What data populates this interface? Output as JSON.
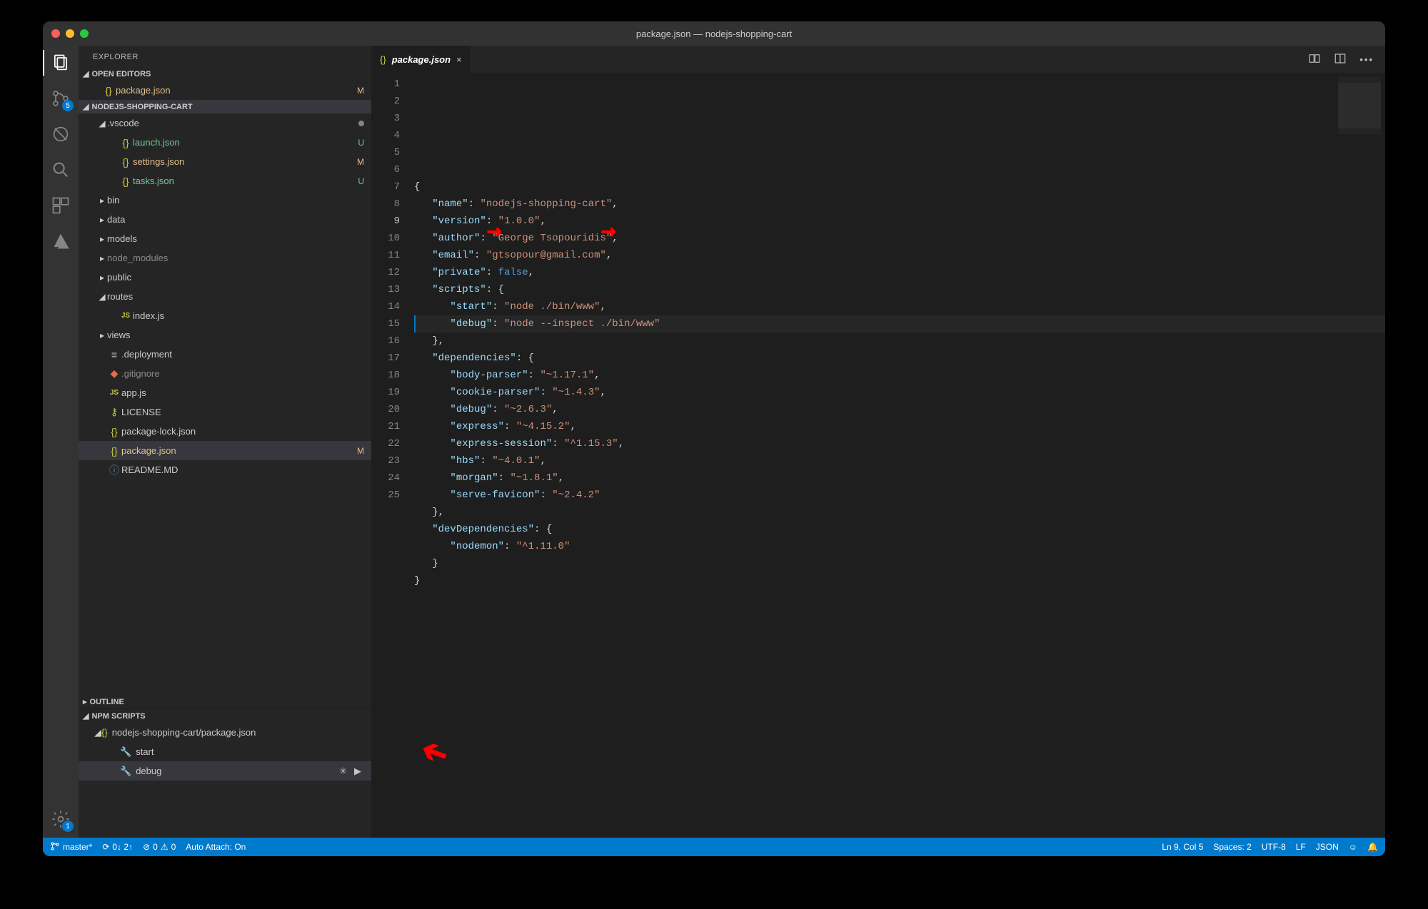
{
  "window": {
    "title": "package.json — nodejs-shopping-cart"
  },
  "activity": {
    "scm_badge": "5",
    "settings_badge": "1"
  },
  "sidebar": {
    "title": "EXPLORER",
    "open_editors": {
      "title": "OPEN EDITORS",
      "items": [
        {
          "label": "package.json",
          "decoration": "M"
        }
      ]
    },
    "workspace": {
      "title": "NODEJS-SHOPPING-CART",
      "tree": [
        {
          "depth": 1,
          "kind": "folder",
          "expanded": true,
          "label": ".vscode",
          "dotdeco": true
        },
        {
          "depth": 2,
          "kind": "json",
          "label": "launch.json",
          "color": "green",
          "decoration": "U"
        },
        {
          "depth": 2,
          "kind": "json",
          "label": "settings.json",
          "color": "gold",
          "decoration": "M"
        },
        {
          "depth": 2,
          "kind": "json",
          "label": "tasks.json",
          "color": "green",
          "decoration": "U"
        },
        {
          "depth": 1,
          "kind": "folder",
          "expanded": false,
          "label": "bin"
        },
        {
          "depth": 1,
          "kind": "folder",
          "expanded": false,
          "label": "data"
        },
        {
          "depth": 1,
          "kind": "folder",
          "expanded": false,
          "label": "models"
        },
        {
          "depth": 1,
          "kind": "folder",
          "expanded": false,
          "label": "node_modules",
          "color": "gray"
        },
        {
          "depth": 1,
          "kind": "folder",
          "expanded": false,
          "label": "public"
        },
        {
          "depth": 1,
          "kind": "folder",
          "expanded": true,
          "label": "routes"
        },
        {
          "depth": 2,
          "kind": "js",
          "label": "index.js"
        },
        {
          "depth": 1,
          "kind": "folder",
          "expanded": false,
          "label": "views"
        },
        {
          "depth": 1,
          "kind": "file",
          "label": ".deployment"
        },
        {
          "depth": 1,
          "kind": "git",
          "label": ".gitignore",
          "color": "gray"
        },
        {
          "depth": 1,
          "kind": "js",
          "label": "app.js"
        },
        {
          "depth": 1,
          "kind": "license",
          "label": "LICENSE"
        },
        {
          "depth": 1,
          "kind": "json",
          "label": "package-lock.json"
        },
        {
          "depth": 1,
          "kind": "json",
          "label": "package.json",
          "color": "gold",
          "decoration": "M",
          "selected": true
        },
        {
          "depth": 1,
          "kind": "info",
          "label": "README.MD"
        }
      ]
    },
    "outline": {
      "title": "OUTLINE"
    },
    "npm": {
      "title": "NPM SCRIPTS",
      "package_path": "nodejs-shopping-cart/package.json",
      "scripts": [
        {
          "name": "start",
          "selected": false
        },
        {
          "name": "debug",
          "selected": true
        }
      ]
    }
  },
  "editor": {
    "tab": {
      "filename": "package.json"
    },
    "active_line": 9,
    "lines": [
      [
        {
          "t": "{",
          "c": "punc"
        }
      ],
      [
        {
          "t": "   ",
          "c": "punc"
        },
        {
          "t": "\"name\"",
          "c": "key"
        },
        {
          "t": ": ",
          "c": "punc"
        },
        {
          "t": "\"nodejs-shopping-cart\"",
          "c": "str"
        },
        {
          "t": ",",
          "c": "punc"
        }
      ],
      [
        {
          "t": "   ",
          "c": "punc"
        },
        {
          "t": "\"version\"",
          "c": "key"
        },
        {
          "t": ": ",
          "c": "punc"
        },
        {
          "t": "\"1.0.0\"",
          "c": "str"
        },
        {
          "t": ",",
          "c": "punc"
        }
      ],
      [
        {
          "t": "   ",
          "c": "punc"
        },
        {
          "t": "\"author\"",
          "c": "key"
        },
        {
          "t": ": ",
          "c": "punc"
        },
        {
          "t": "\"George Tsopouridis\"",
          "c": "str"
        },
        {
          "t": ",",
          "c": "punc"
        }
      ],
      [
        {
          "t": "   ",
          "c": "punc"
        },
        {
          "t": "\"email\"",
          "c": "key"
        },
        {
          "t": ": ",
          "c": "punc"
        },
        {
          "t": "\"gtsopour@gmail.com\"",
          "c": "str"
        },
        {
          "t": ",",
          "c": "punc"
        }
      ],
      [
        {
          "t": "   ",
          "c": "punc"
        },
        {
          "t": "\"private\"",
          "c": "key"
        },
        {
          "t": ": ",
          "c": "punc"
        },
        {
          "t": "false",
          "c": "bool"
        },
        {
          "t": ",",
          "c": "punc"
        }
      ],
      [
        {
          "t": "   ",
          "c": "punc"
        },
        {
          "t": "\"scripts\"",
          "c": "key"
        },
        {
          "t": ": {",
          "c": "punc"
        }
      ],
      [
        {
          "t": "      ",
          "c": "punc"
        },
        {
          "t": "\"start\"",
          "c": "key"
        },
        {
          "t": ": ",
          "c": "punc"
        },
        {
          "t": "\"node ./bin/www\"",
          "c": "str"
        },
        {
          "t": ",",
          "c": "punc"
        }
      ],
      [
        {
          "t": "      ",
          "c": "punc"
        },
        {
          "t": "\"debug\"",
          "c": "key"
        },
        {
          "t": ": ",
          "c": "punc"
        },
        {
          "t": "\"node --inspect ./bin/www\"",
          "c": "str"
        }
      ],
      [
        {
          "t": "   },",
          "c": "punc"
        }
      ],
      [
        {
          "t": "   ",
          "c": "punc"
        },
        {
          "t": "\"dependencies\"",
          "c": "key"
        },
        {
          "t": ": {",
          "c": "punc"
        }
      ],
      [
        {
          "t": "      ",
          "c": "punc"
        },
        {
          "t": "\"body-parser\"",
          "c": "key"
        },
        {
          "t": ": ",
          "c": "punc"
        },
        {
          "t": "\"~1.17.1\"",
          "c": "str"
        },
        {
          "t": ",",
          "c": "punc"
        }
      ],
      [
        {
          "t": "      ",
          "c": "punc"
        },
        {
          "t": "\"cookie-parser\"",
          "c": "key"
        },
        {
          "t": ": ",
          "c": "punc"
        },
        {
          "t": "\"~1.4.3\"",
          "c": "str"
        },
        {
          "t": ",",
          "c": "punc"
        }
      ],
      [
        {
          "t": "      ",
          "c": "punc"
        },
        {
          "t": "\"debug\"",
          "c": "key"
        },
        {
          "t": ": ",
          "c": "punc"
        },
        {
          "t": "\"~2.6.3\"",
          "c": "str"
        },
        {
          "t": ",",
          "c": "punc"
        }
      ],
      [
        {
          "t": "      ",
          "c": "punc"
        },
        {
          "t": "\"express\"",
          "c": "key"
        },
        {
          "t": ": ",
          "c": "punc"
        },
        {
          "t": "\"~4.15.2\"",
          "c": "str"
        },
        {
          "t": ",",
          "c": "punc"
        }
      ],
      [
        {
          "t": "      ",
          "c": "punc"
        },
        {
          "t": "\"express-session\"",
          "c": "key"
        },
        {
          "t": ": ",
          "c": "punc"
        },
        {
          "t": "\"^1.15.3\"",
          "c": "str"
        },
        {
          "t": ",",
          "c": "punc"
        }
      ],
      [
        {
          "t": "      ",
          "c": "punc"
        },
        {
          "t": "\"hbs\"",
          "c": "key"
        },
        {
          "t": ": ",
          "c": "punc"
        },
        {
          "t": "\"~4.0.1\"",
          "c": "str"
        },
        {
          "t": ",",
          "c": "punc"
        }
      ],
      [
        {
          "t": "      ",
          "c": "punc"
        },
        {
          "t": "\"morgan\"",
          "c": "key"
        },
        {
          "t": ": ",
          "c": "punc"
        },
        {
          "t": "\"~1.8.1\"",
          "c": "str"
        },
        {
          "t": ",",
          "c": "punc"
        }
      ],
      [
        {
          "t": "      ",
          "c": "punc"
        },
        {
          "t": "\"serve-favicon\"",
          "c": "key"
        },
        {
          "t": ": ",
          "c": "punc"
        },
        {
          "t": "\"~2.4.2\"",
          "c": "str"
        }
      ],
      [
        {
          "t": "   },",
          "c": "punc"
        }
      ],
      [
        {
          "t": "   ",
          "c": "punc"
        },
        {
          "t": "\"devDependencies\"",
          "c": "key"
        },
        {
          "t": ": {",
          "c": "punc"
        }
      ],
      [
        {
          "t": "      ",
          "c": "punc"
        },
        {
          "t": "\"nodemon\"",
          "c": "key"
        },
        {
          "t": ": ",
          "c": "punc"
        },
        {
          "t": "\"^1.11.0\"",
          "c": "str"
        }
      ],
      [
        {
          "t": "   }",
          "c": "punc"
        }
      ],
      [
        {
          "t": "}",
          "c": "punc"
        }
      ],
      []
    ]
  },
  "status": {
    "branch": "master*",
    "sync": "0↓ 2↑",
    "errors": "0",
    "warnings": "0",
    "auto_attach": "Auto Attach: On",
    "position": "Ln 9, Col 5",
    "spaces": "Spaces: 2",
    "encoding": "UTF-8",
    "eol": "LF",
    "language": "JSON"
  }
}
